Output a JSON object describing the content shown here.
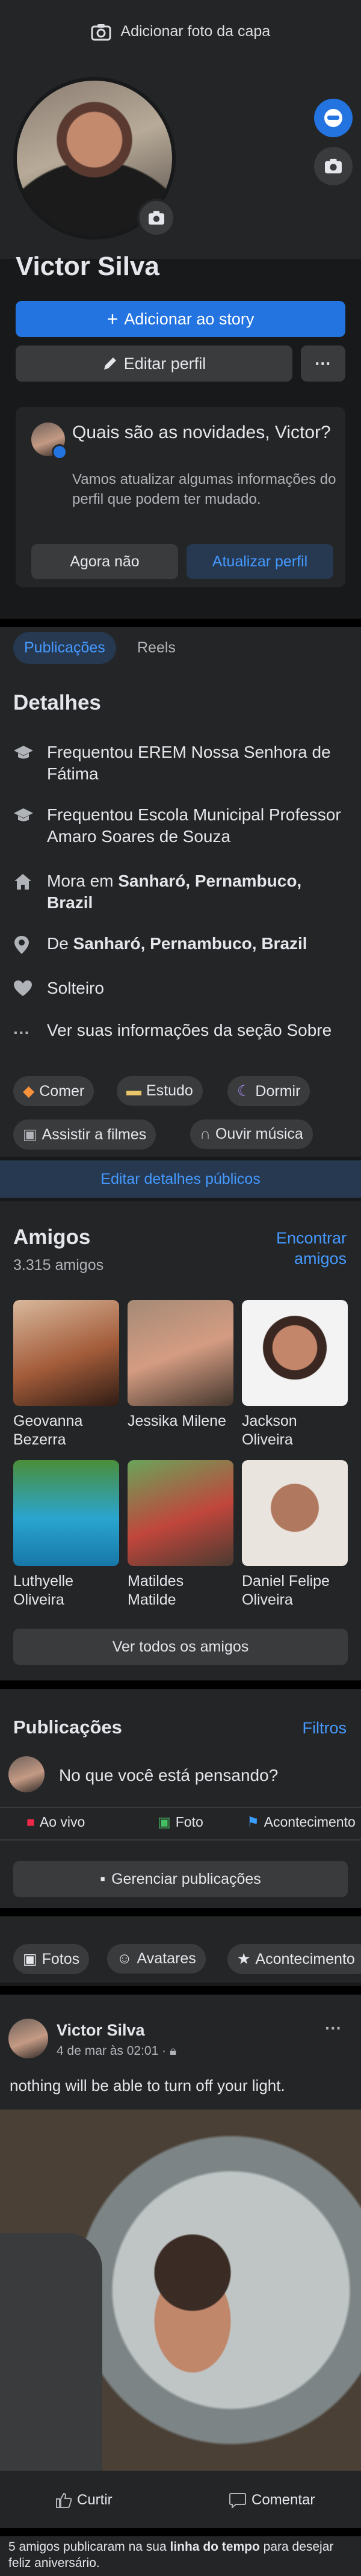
{
  "profile": {
    "add_cover": "Adicionar foto da capa",
    "name": "Victor Silva",
    "add_story": "Adicionar ao story",
    "edit_profile": "Editar perfil",
    "more": "···"
  },
  "update_card": {
    "title": "Quais são as novidades, Victor?",
    "subtitle": "Vamos atualizar algumas informações do perfil que podem ter mudado.",
    "not_now": "Agora não",
    "update": "Atualizar perfil"
  },
  "tabs": [
    "Publicações",
    "Reels"
  ],
  "details": {
    "title": "Detalhes",
    "items": [
      {
        "icon": "graduation-cap-icon",
        "text": "Frequentou EREM Nossa Senhora de Fátima"
      },
      {
        "icon": "graduation-cap-icon",
        "text": "Frequentou Escola Municipal Professor Amaro Soares de Souza"
      },
      {
        "icon": "home-icon",
        "prefix": "Mora em ",
        "bold": "Sanharó, Pernambuco, Brazil"
      },
      {
        "icon": "location-pin-icon",
        "prefix": "De ",
        "bold": "Sanharó, Pernambuco, Brazil"
      },
      {
        "icon": "heart-icon",
        "text": "Solteiro"
      },
      {
        "icon": "more-dots-icon",
        "text": "Ver suas informações da seção Sobre"
      }
    ],
    "hobbies": [
      "Comer",
      "Estudo",
      "Dormir",
      "Assistir a filmes",
      "Ouvir música"
    ],
    "edit_public": "Editar detalhes públicos"
  },
  "friends": {
    "title": "Amigos",
    "count": "3.315 amigos",
    "find": "Encontrar amigos",
    "list": [
      "Geovanna Bezerra",
      "Jessika Milene",
      "Jackson Oliveira",
      "Luthyelle Oliveira",
      "Matildes Matilde",
      "Daniel Felipe Oliveira"
    ],
    "see_all": "Ver todos os amigos"
  },
  "posts": {
    "title": "Publicações",
    "filters": "Filtros",
    "composer_placeholder": "No que você está pensando?",
    "actions": [
      "Ao vivo",
      "Foto",
      "Acontecimento"
    ],
    "manage": "Gerenciar publicações",
    "pills": [
      "Fotos",
      "Avatares",
      "Acontecimento"
    ]
  },
  "post": {
    "author": "Victor Silva",
    "date": "4 de mar às 02:01 · ",
    "text": "nothing will be able to turn off your light.",
    "like": "Curtir",
    "comment": "Comentar"
  },
  "footer": {
    "text_a": "5 amigos publicaram na sua ",
    "text_bold": "linha do tempo",
    "text_b": " para desejar feliz aniversário."
  },
  "colors": {
    "accent": "#2374e1",
    "link": "#4599ff",
    "surface": "#242526",
    "background": "#18191a"
  }
}
